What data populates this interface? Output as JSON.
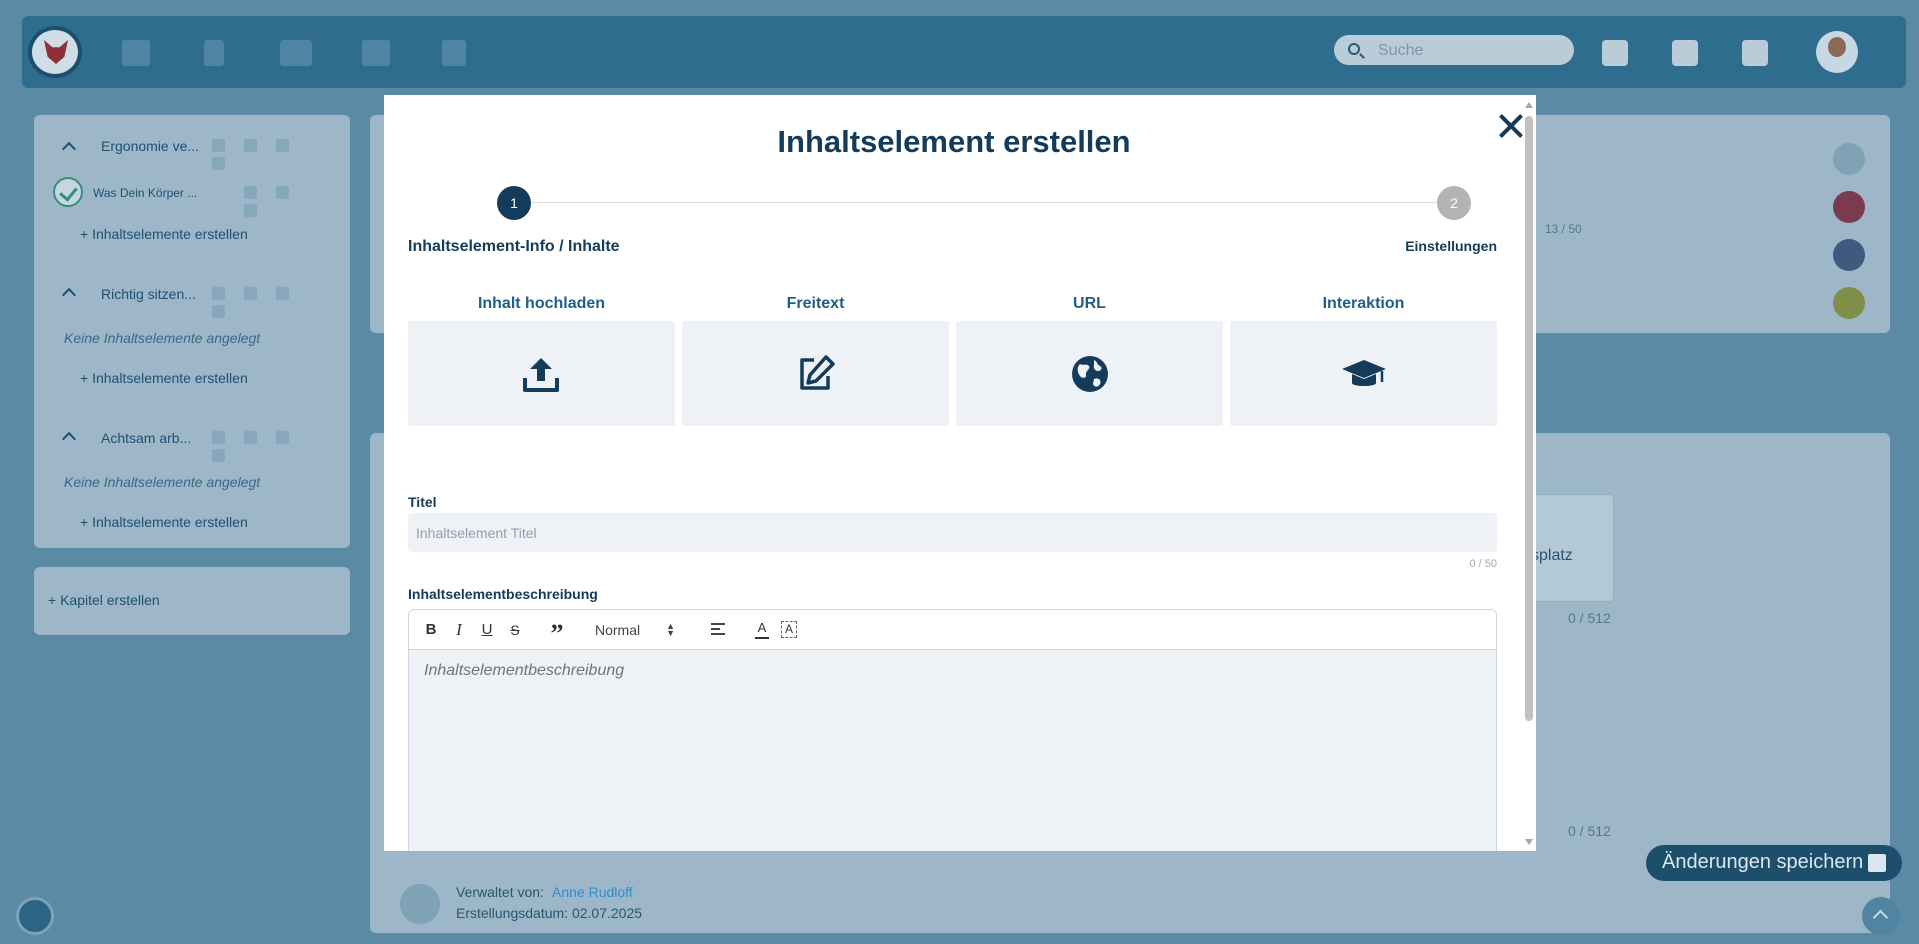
{
  "app": {
    "search_placeholder": "Suche",
    "nav_icons": [
      "monitor-icon",
      "bookmark-icon",
      "graduation-cap-icon",
      "teacher-icon",
      "brush-icon"
    ],
    "top_icons": [
      "bell-icon",
      "bar-chart-icon",
      "gear-icon"
    ]
  },
  "sidebar": {
    "sections": [
      {
        "title": "Ergonomie ve...",
        "items": [
          {
            "label": "Was Dein Körper ..."
          }
        ],
        "add_label": "Inhaltselemente erstellen"
      },
      {
        "title": "Richtig sitzen...",
        "empty": "Keine Inhaltselemente angelegt",
        "add_label": "Inhaltselemente erstellen"
      },
      {
        "title": "Achtsam arb...",
        "empty": "Keine Inhaltselemente angelegt",
        "add_label": "Inhaltselemente erstellen"
      }
    ],
    "create_chapter": "Kapitel erstellen"
  },
  "background": {
    "counter_top": "13 / 50",
    "field_text": "splatz",
    "counter_mid": "0 / 512",
    "counter_low": "0 / 512",
    "managed_by_label": "Verwaltet von:",
    "managed_by_name": "Anne Rudloff",
    "created_label": "Erstellungsdatum: 02.07.2025",
    "save_button": "Änderungen speichern"
  },
  "modal": {
    "title": "Inhaltselement erstellen",
    "steps": [
      {
        "number": "1",
        "label": "Inhaltselement-Info / Inhalte",
        "active": true
      },
      {
        "number": "2",
        "label": "Einstellungen",
        "active": false
      }
    ],
    "content_types": [
      {
        "label": "Inhalt hochladen",
        "icon": "upload-icon"
      },
      {
        "label": "Freitext",
        "icon": "edit-icon"
      },
      {
        "label": "URL",
        "icon": "globe-icon"
      },
      {
        "label": "Interaktion",
        "icon": "graduation-cap-icon"
      }
    ],
    "title_field": {
      "label": "Titel",
      "placeholder": "Inhaltselement Titel",
      "value": "",
      "counter": "0 / 50"
    },
    "description_field": {
      "label": "Inhaltselementbeschreibung",
      "placeholder": "Inhaltselementbeschreibung",
      "toolbar": {
        "bold": "B",
        "italic": "I",
        "underline": "U",
        "strike": "S",
        "quote": "”",
        "header_select": "Normal",
        "color": "A",
        "background": "A"
      }
    }
  },
  "colors": {
    "primary": "#143c5a",
    "accent": "#1f5f86",
    "overlay": "#5b8aa5",
    "tile_bg": "#eef2f6"
  }
}
